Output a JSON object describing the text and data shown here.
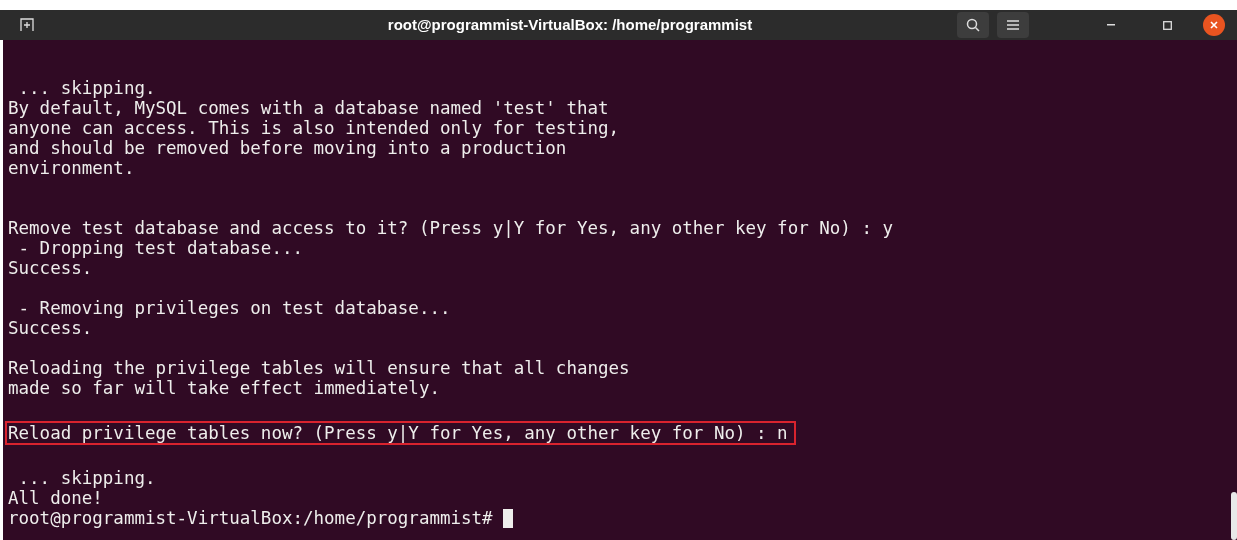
{
  "window": {
    "title": "root@programmist-VirtualBox: /home/programmist"
  },
  "terminal": {
    "lines": [
      {
        "kind": "text",
        "text": " ... skipping.",
        "highlighted": false
      },
      {
        "kind": "text",
        "text": "By default, MySQL comes with a database named 'test' that",
        "highlighted": false
      },
      {
        "kind": "text",
        "text": "anyone can access. This is also intended only for testing,",
        "highlighted": false
      },
      {
        "kind": "text",
        "text": "and should be removed before moving into a production",
        "highlighted": false
      },
      {
        "kind": "text",
        "text": "environment.",
        "highlighted": false
      },
      {
        "kind": "blank"
      },
      {
        "kind": "blank"
      },
      {
        "kind": "text",
        "text": "Remove test database and access to it? (Press y|Y for Yes, any other key for No) : y",
        "highlighted": false
      },
      {
        "kind": "text",
        "text": " - Dropping test database...",
        "highlighted": false
      },
      {
        "kind": "text",
        "text": "Success.",
        "highlighted": false
      },
      {
        "kind": "blank"
      },
      {
        "kind": "text",
        "text": " - Removing privileges on test database...",
        "highlighted": false
      },
      {
        "kind": "text",
        "text": "Success.",
        "highlighted": false
      },
      {
        "kind": "blank"
      },
      {
        "kind": "text",
        "text": "Reloading the privilege tables will ensure that all changes",
        "highlighted": false
      },
      {
        "kind": "text",
        "text": "made so far will take effect immediately.",
        "highlighted": false
      },
      {
        "kind": "blank"
      },
      {
        "kind": "text",
        "text": "Reload privilege tables now? (Press y|Y for Yes, any other key for No) : n",
        "highlighted": true
      },
      {
        "kind": "blank"
      },
      {
        "kind": "text",
        "text": " ... skipping.",
        "highlighted": false
      },
      {
        "kind": "text",
        "text": "All done!",
        "highlighted": false
      },
      {
        "kind": "prompt",
        "text": "root@programmist-VirtualBox:/home/programmist# ",
        "highlighted": false,
        "cursor": true
      }
    ]
  }
}
